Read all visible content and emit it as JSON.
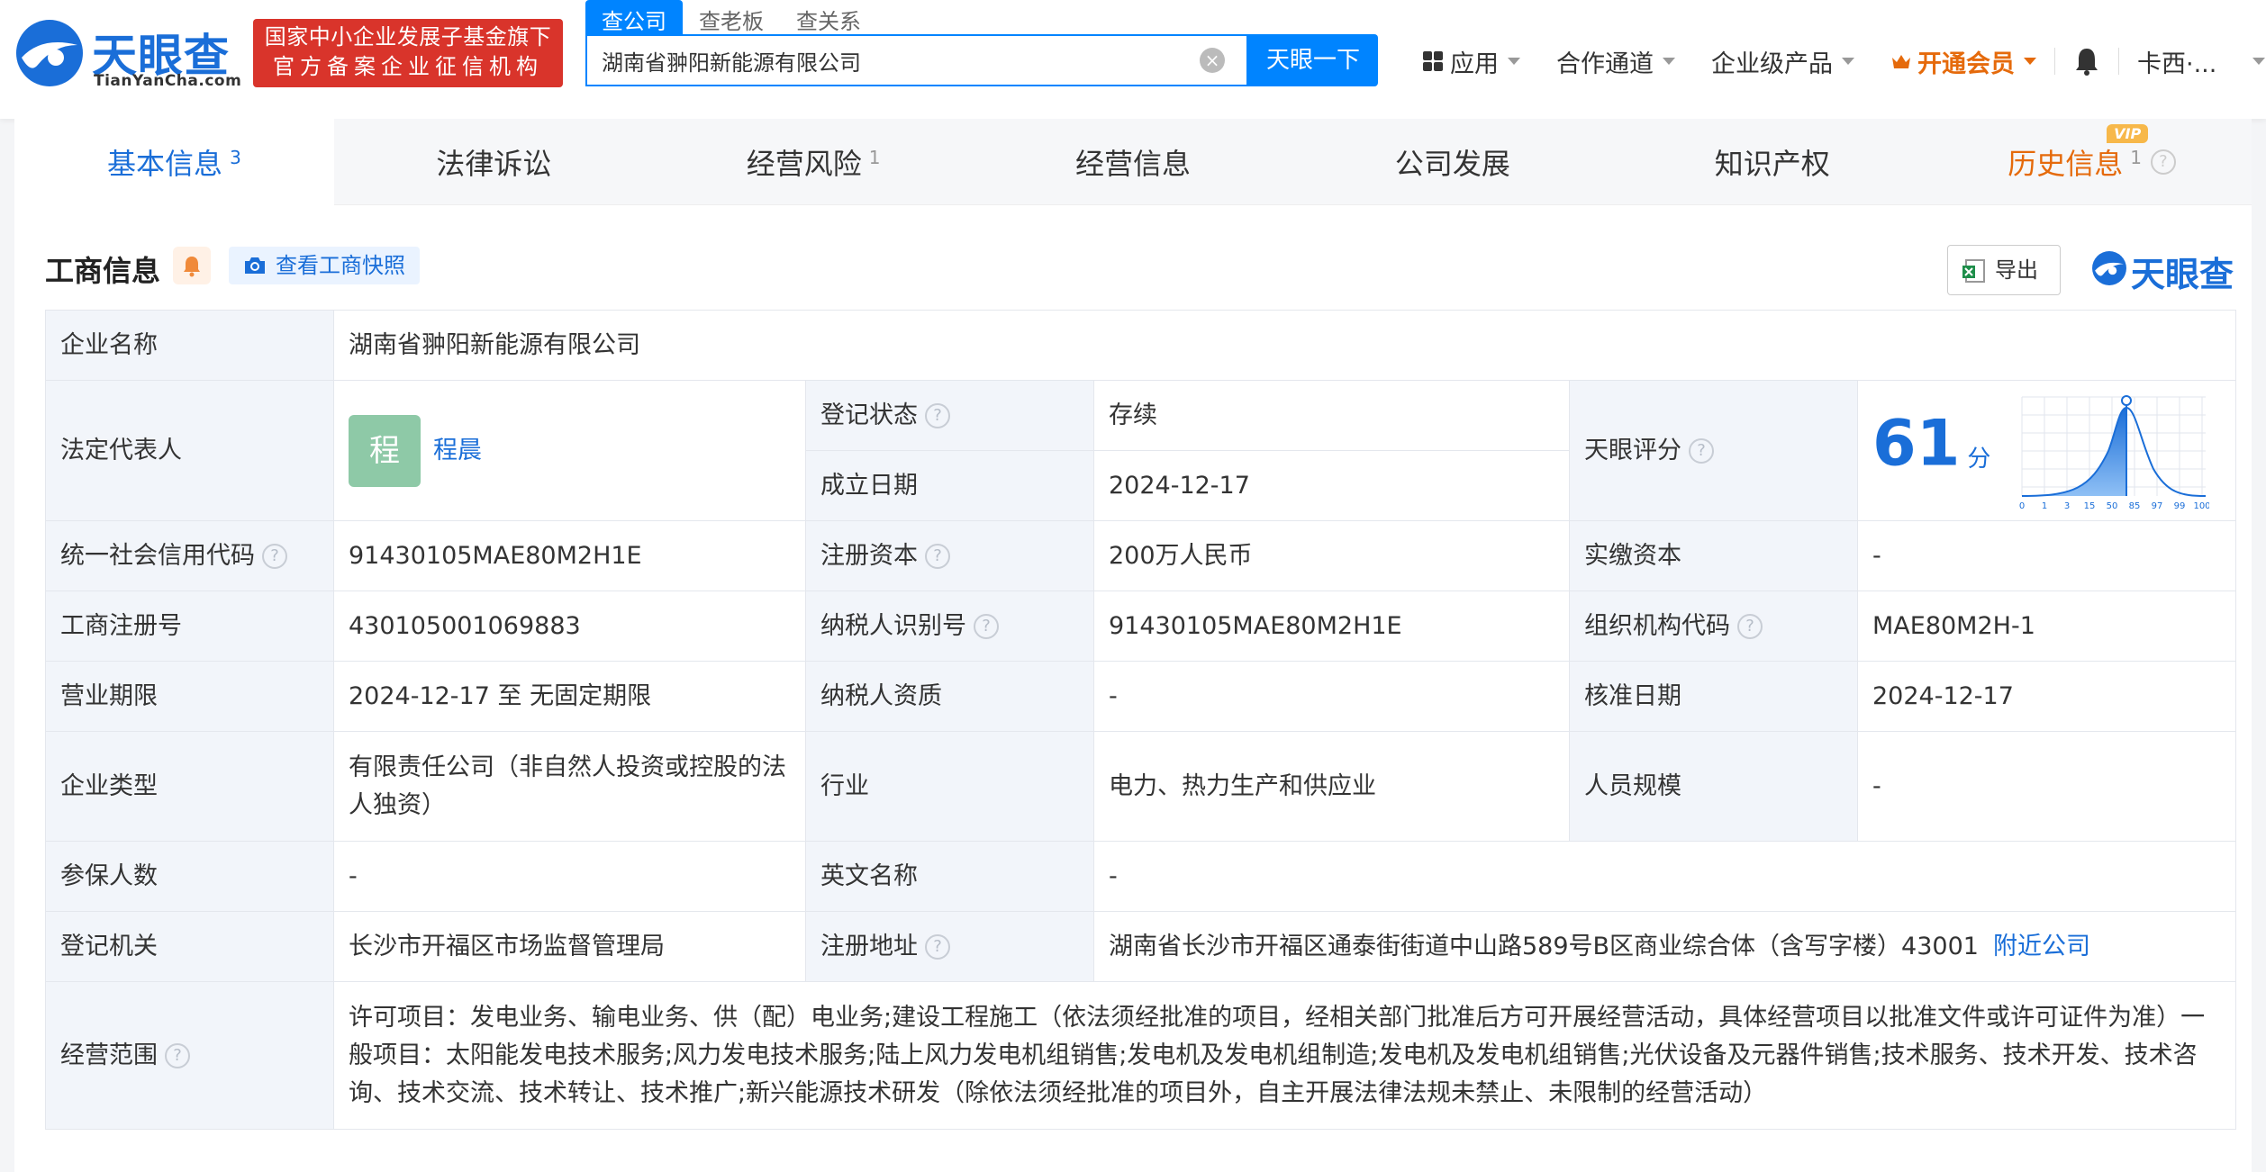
{
  "header": {
    "logo_text": "天眼查",
    "logo_sub": "TianYanCha.com",
    "gov_line1": "国家中小企业发展子基金旗下",
    "gov_line2": "官方备案企业征信机构",
    "search_tabs": [
      "查公司",
      "查老板",
      "查关系"
    ],
    "search_value": "湖南省翀阳新能源有限公司",
    "search_button": "天眼一下",
    "nav": {
      "apps": "应用",
      "channel": "合作通道",
      "enterprise": "企业级产品",
      "vip": "开通会员",
      "user": "卡西·..."
    }
  },
  "tabs": [
    {
      "label": "基本信息",
      "count": "3"
    },
    {
      "label": "法律诉讼",
      "count": ""
    },
    {
      "label": "经营风险",
      "count": "1"
    },
    {
      "label": "经营信息",
      "count": ""
    },
    {
      "label": "公司发展",
      "count": ""
    },
    {
      "label": "知识产权",
      "count": ""
    },
    {
      "label": "历史信息",
      "count": "1",
      "tag": "VIP"
    }
  ],
  "section": {
    "title": "工商信息",
    "snapshot": "查看工商快照",
    "export": "导出",
    "brand": "天眼查"
  },
  "info": {
    "company_name_label": "企业名称",
    "company_name": "湖南省翀阳新能源有限公司",
    "legal_rep_label": "法定代表人",
    "legal_rep_avatar": "程",
    "legal_rep": "程晨",
    "status_label": "登记状态",
    "status": "存续",
    "found_date_label": "成立日期",
    "found_date": "2024-12-17",
    "score_label": "天眼评分",
    "score": "61",
    "score_unit": "分",
    "score_ticks": [
      "0",
      "1",
      "3",
      "15",
      "50",
      "85",
      "97",
      "99",
      "100"
    ],
    "credit_code_label": "统一社会信用代码",
    "credit_code": "91430105MAE80M2H1E",
    "reg_capital_label": "注册资本",
    "reg_capital": "200万人民币",
    "paid_capital_label": "实缴资本",
    "paid_capital": "-",
    "reg_no_label": "工商注册号",
    "reg_no": "430105001069883",
    "taxpayer_id_label": "纳税人识别号",
    "taxpayer_id": "91430105MAE80M2H1E",
    "org_code_label": "组织机构代码",
    "org_code": "MAE80M2H-1",
    "term_label": "营业期限",
    "term": "2024-12-17 至 无固定期限",
    "taxpayer_qual_label": "纳税人资质",
    "taxpayer_qual": "-",
    "approve_date_label": "核准日期",
    "approve_date": "2024-12-17",
    "type_label": "企业类型",
    "type": "有限责任公司（非自然人投资或控股的法人独资）",
    "industry_label": "行业",
    "industry": "电力、热力生产和供应业",
    "staff_label": "人员规模",
    "staff": "-",
    "insured_label": "参保人数",
    "insured": "-",
    "en_name_label": "英文名称",
    "en_name": "-",
    "authority_label": "登记机关",
    "authority": "长沙市开福区市场监督管理局",
    "address_label": "注册地址",
    "address": "湖南省长沙市开福区通泰街街道中山路589号B区商业综合体（含写字楼）43001",
    "nearby": "附近公司",
    "scope_label": "经营范围",
    "scope": "许可项目：发电业务、输电业务、供（配）电业务;建设工程施工（依法须经批准的项目，经相关部门批准后方可开展经营活动，具体经营项目以批准文件或许可证件为准）一般项目：太阳能发电技术服务;风力发电技术服务;陆上风力发电机组销售;发电机及发电机组制造;发电机及发电机组销售;光伏设备及元器件销售;技术服务、技术开发、技术咨询、技术交流、技术转让、技术推广;新兴能源技术研发（除依法须经批准的项目外，自主开展法律法规未禁止、未限制的经营活动）"
  },
  "colors": {
    "brand_blue": "#1a6ed8",
    "search_blue": "#0084ff",
    "badge_red": "#d9342b",
    "vip_orange": "#e56a0b",
    "status_green": "#3aa14e"
  }
}
